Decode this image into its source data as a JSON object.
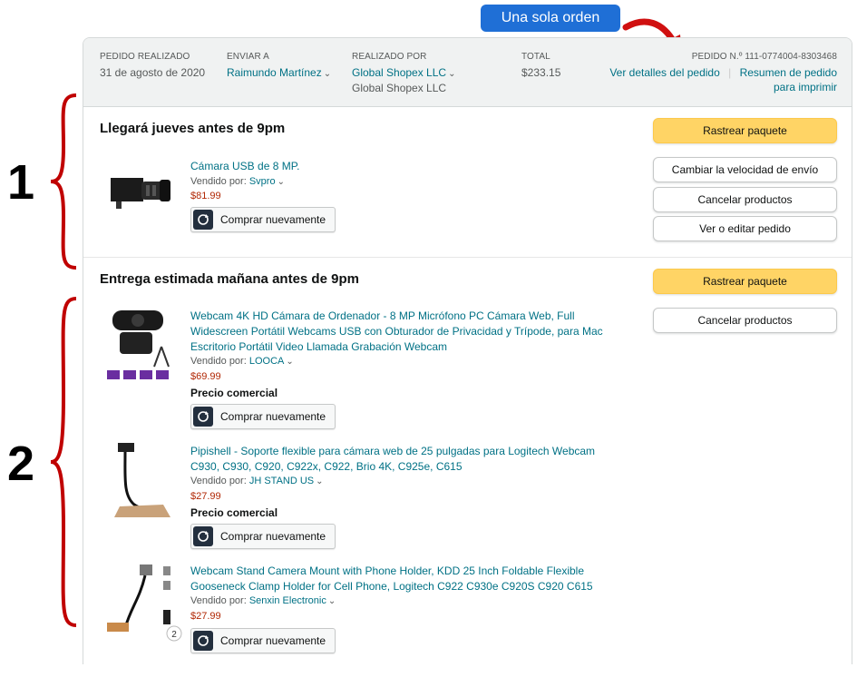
{
  "callout": {
    "label": "Una sola orden"
  },
  "header": {
    "placed_label": "PEDIDO REALIZADO",
    "placed_value": "31 de agosto de 2020",
    "ship_label": "ENVIAR A",
    "ship_value": "Raimundo Martínez",
    "by_label": "REALIZADO POR",
    "by_value": "Global Shopex LLC",
    "by_value2": "Global Shopex LLC",
    "total_label": "TOTAL",
    "total_value": "$233.15",
    "order_number": "PEDIDO N.º 111-0774004-8303468",
    "details_link": "Ver detalles del pedido",
    "print_link_1": "Resumen de pedido",
    "print_link_2": "para imprimir"
  },
  "shipments": [
    {
      "number": "1",
      "title": "Llegará jueves antes de 9pm",
      "buttons": [
        "Rastrear paquete",
        "Cambiar la velocidad de envío",
        "Cancelar productos",
        "Ver o editar pedido"
      ],
      "items": [
        {
          "title_lines": [
            "Cámara USB de 8 MP."
          ],
          "seller_label": "Vendido por:",
          "seller": "Svpro",
          "price": "$81.99",
          "buy": "Comprar nuevamente"
        }
      ]
    },
    {
      "number": "2",
      "title": "Entrega estimada mañana antes de 9pm",
      "buttons": [
        "Rastrear paquete",
        "Cancelar productos"
      ],
      "items": [
        {
          "title_lines": [
            "Webcam 4K HD Cámara de Ordenador - 8 MP Micrófono PC Cámara Web, Full",
            "Widescreen Portátil Webcams USB con Obturador de Privacidad y Trípode, para Mac",
            "Escritorio Portátil Video Llamada Grabación Webcam"
          ],
          "seller_label": "Vendido por:",
          "seller": "LOOCA",
          "price": "$69.99",
          "tag": "Precio comercial",
          "buy": "Comprar nuevamente"
        },
        {
          "title_lines": [
            "Pipishell - Soporte flexible para cámara web de 25 pulgadas para Logitech Webcam",
            "C930, C930, C920, C922x, C922, Brio 4K, C925e, C615"
          ],
          "seller_label": "Vendido por:",
          "seller": "JH STAND US",
          "price": "$27.99",
          "tag": "Precio comercial",
          "buy": "Comprar nuevamente"
        },
        {
          "title_lines": [
            "Webcam Stand Camera Mount with Phone Holder, KDD 25 Inch Foldable Flexible",
            "Gooseneck Clamp Holder for Cell Phone, Logitech C922 C930e C920S C920 C615"
          ],
          "seller_label": "Vendido por:",
          "seller": "Senxin Electronic",
          "price": "$27.99",
          "buy": "Comprar nuevamente",
          "image_badge": "2"
        }
      ]
    }
  ],
  "colors": {
    "link": "#007185",
    "price": "#B12704",
    "primary_button": "#FFD465",
    "brace": "#C00000",
    "callout": "#1F6FD6"
  }
}
